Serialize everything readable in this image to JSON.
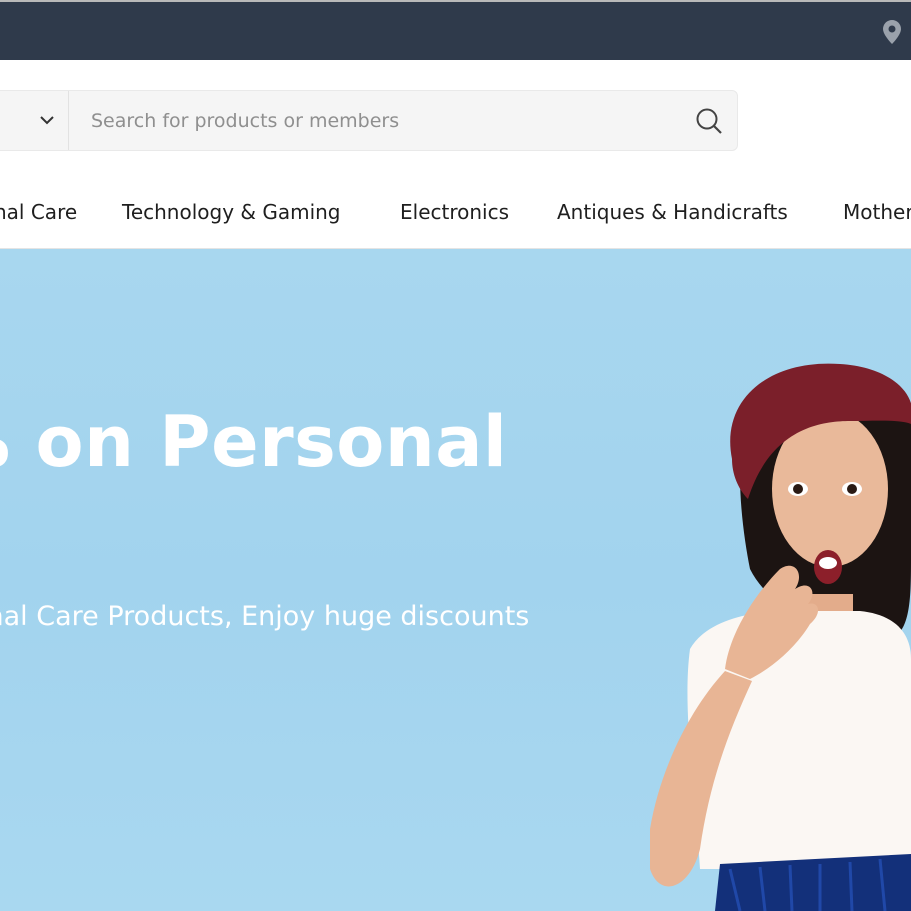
{
  "topbar": {
    "location_icon": "location-pin-icon"
  },
  "search": {
    "category_icon": "chevron-down-icon",
    "placeholder": "Search for products or members",
    "search_icon": "search-icon"
  },
  "nav": {
    "items": [
      {
        "label": "nal Care"
      },
      {
        "label": "Technology & Gaming"
      },
      {
        "label": "Electronics"
      },
      {
        "label": "Antiques & Handicrafts"
      },
      {
        "label": "Mother"
      }
    ]
  },
  "hero": {
    "headline": "% on Personal",
    "subline": "onal Care Products, Enjoy huge discounts",
    "background_color": "#a6d5ef",
    "text_color": "#ffffff"
  },
  "colors": {
    "topbar": "#2f3a4b"
  }
}
